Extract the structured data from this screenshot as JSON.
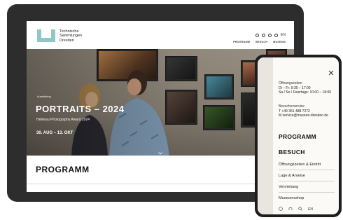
{
  "tablet": {
    "header": {
      "logo_lines": [
        "Technische",
        "Sammlungen",
        "Dresden"
      ],
      "nav": [
        "PROGRAMM",
        "BESUCH",
        "MUSEUM"
      ],
      "lang": "EN"
    },
    "hero": {
      "kicker": "Ausstellung",
      "title": "PORTRAITS – 2024",
      "subtitle": "Hellerau Photography Award 2024",
      "dates": "30. AUG – 13. OKT"
    },
    "section_heading": "PROGRAMM"
  },
  "phone": {
    "hours": {
      "label": "Öffnungszeiten",
      "line1": "Di – Fr: 9:30 – 17:00",
      "line2": "Sa / So / Feiertage: 10:00 – 18:00"
    },
    "service": {
      "label": "Besucherservice",
      "phone": "T   +49 351 488 7272",
      "email": "M   service@museen-dresden.de"
    },
    "menu_big": [
      "PROGRAMM",
      "BESUCH"
    ],
    "menu_links": [
      "Öffnungszeiten & Eintritt",
      "Lage & Anreise",
      "Vermietung",
      "Museumsshop"
    ],
    "lang": "EN"
  },
  "colors": {
    "brand_teal": "#8fc7c6",
    "dark": "#111111"
  }
}
